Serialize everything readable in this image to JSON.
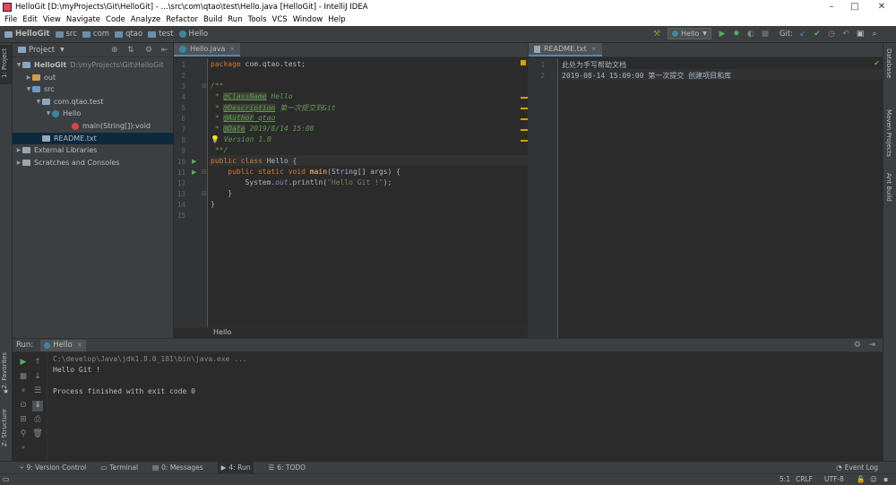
{
  "window": {
    "title": "HelloGit [D:\\myProjects\\Git\\HelloGit] - ...\\src\\com\\qtao\\test\\Hello.java [HelloGit] - IntelliJ IDEA",
    "minimize": "–",
    "maximize": "□",
    "close": "✕"
  },
  "menu": [
    "File",
    "Edit",
    "View",
    "Navigate",
    "Code",
    "Analyze",
    "Refactor",
    "Build",
    "Run",
    "Tools",
    "VCS",
    "Window",
    "Help"
  ],
  "breadcrumbs": [
    "HelloGit",
    "src",
    "com",
    "qtao",
    "test",
    "Hello"
  ],
  "toolbar": {
    "run_config": "Hello",
    "git_label": "Git:"
  },
  "left_tabs": {
    "project": "1: Project",
    "favorites": "2: Favorites",
    "structure": "Z: Structure"
  },
  "right_tabs": {
    "database": "Database",
    "maven": "Maven Projects",
    "ant": "Ant Build"
  },
  "project": {
    "header": "Project",
    "tree": [
      {
        "label": "HelloGit",
        "extra": "D:\\myProjects\\Git\\HelloGit",
        "indent": 0,
        "arrow": "▼",
        "icon": "project-folder-icon",
        "color": "#8aa4c1",
        "bold": true
      },
      {
        "label": "out",
        "indent": 1,
        "arrow": "▶",
        "icon": "folder-icon",
        "color": "#d09b4e"
      },
      {
        "label": "src",
        "indent": 1,
        "arrow": "▼",
        "icon": "source-folder-icon",
        "color": "#6d9bc3"
      },
      {
        "label": "com.qtao.test",
        "indent": 2,
        "arrow": "▼",
        "icon": "package-icon",
        "color": "#8aa4c1"
      },
      {
        "label": "Hello",
        "indent": 3,
        "arrow": "▼",
        "icon": "class-icon",
        "color": "#3e86a0"
      },
      {
        "label": "main(String[]):void",
        "indent": 5,
        "arrow": "",
        "icon": "method-icon",
        "color": "#cc4b4b"
      },
      {
        "label": "README.txt",
        "indent": 2,
        "arrow": "",
        "icon": "text-file-icon",
        "color": "#9aa7b0",
        "selected": true
      },
      {
        "label": "External Libraries",
        "indent": 0,
        "arrow": "▶",
        "icon": "libraries-icon",
        "color": "#9aa7b0"
      },
      {
        "label": "Scratches and Consoles",
        "indent": 0,
        "arrow": "▶",
        "icon": "scratches-icon",
        "color": "#9aa7b0"
      }
    ]
  },
  "editor": {
    "tab": "Hello.java",
    "breadcrumb": "Hello",
    "line_numbers": [
      "1",
      "2",
      "3",
      "4",
      "5",
      "6",
      "7",
      "8",
      "9",
      "10",
      "11",
      "12",
      "13",
      "14",
      "15"
    ],
    "code": {
      "l1_kw": "package",
      "l1_rest": " com.qtao.test;",
      "l3": "/**",
      "l4_tag": "@ClassName",
      "l4_val": " Hello",
      "l5_tag": "@Description",
      "l5_val": " 第一次提交到Git",
      "l6_tag": "@Author",
      "l6_val": " qtao",
      "l7_tag": "@Date",
      "l7_val": " 2019/8/14 15:08",
      "l8": " Version 1.0",
      "l9": " **/",
      "l10_kw": "public class",
      "l10_rest": " Hello {",
      "l11_kw": "    public static void",
      "l11_fn": " main",
      "l11_rest": "(String[] args) {",
      "l12_a": "        System.",
      "l12_fld": "out",
      "l12_b": ".println(",
      "l12_str": "\"Hello Git !\"",
      "l12_c": ");",
      "l13": "    }",
      "l14": "}",
      "star": " * "
    }
  },
  "readme": {
    "tab": "README.txt",
    "line_numbers": [
      "1",
      "2"
    ],
    "lines": [
      "此处为手写帮助文档",
      "2019-08-14 15:09:00 第一次提交 创建项目和库"
    ]
  },
  "run": {
    "label": "Run:",
    "tab": "Hello",
    "console": [
      "C:\\develop\\Java\\jdk1.8.0_181\\bin\\java.exe ...",
      "Hello Git !",
      "",
      "Process finished with exit code 0"
    ]
  },
  "bottom_tools": [
    {
      "label": "9: Version Control",
      "icon": "vcs-icon"
    },
    {
      "label": "Terminal",
      "icon": "terminal-icon"
    },
    {
      "label": "0: Messages",
      "icon": "messages-icon"
    },
    {
      "label": "4: Run",
      "icon": "run-icon",
      "active": true
    },
    {
      "label": "6: TODO",
      "icon": "todo-icon"
    }
  ],
  "event_log": "Event Log",
  "status": {
    "position": "5:1",
    "line_sep": "CRLF",
    "encoding": "UTF-8"
  }
}
